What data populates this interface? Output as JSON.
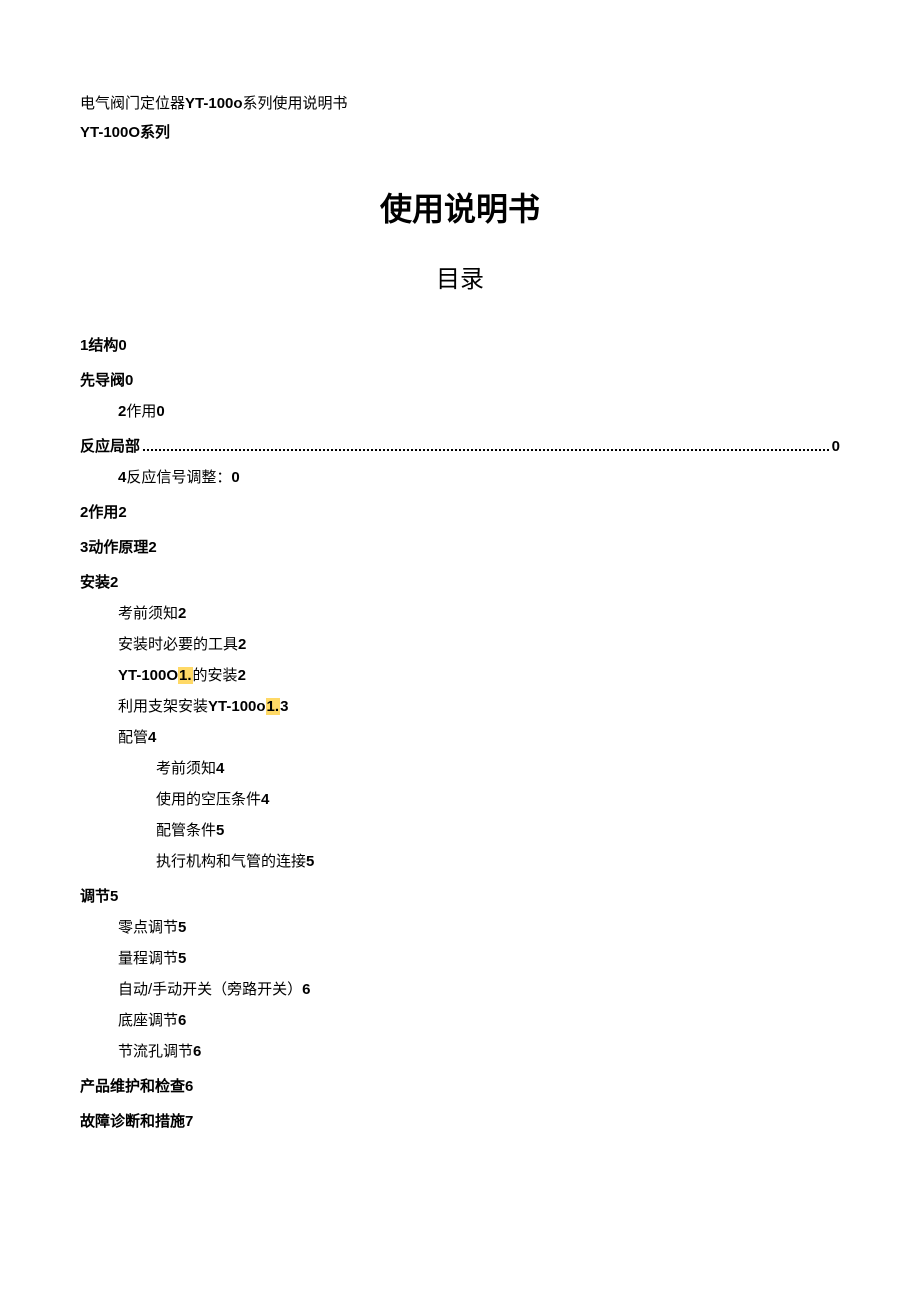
{
  "header": {
    "line1_prefix": "电气阀门定位器",
    "line1_model": "YT-100o",
    "line1_suffix": "系列使用说明书",
    "line2": "YT-100O系列"
  },
  "title": "使用说明书",
  "subtitle": "目录",
  "toc": {
    "e1": {
      "num": "1",
      "text": "结构",
      "page": "0"
    },
    "e2": {
      "text": "先导阀",
      "page": "0"
    },
    "e3": {
      "num": "2",
      "text": "作用",
      "page": "0"
    },
    "e4": {
      "text": "反应局部",
      "page": "0"
    },
    "e5": {
      "num": "4",
      "text": "反应信号调整：",
      "page": "0"
    },
    "e6": {
      "num": "2",
      "text": "作用",
      "page": "2"
    },
    "e7": {
      "num": "3",
      "text": "动作原理",
      "page": "2"
    },
    "e8": {
      "text": "安装",
      "page": "2"
    },
    "e9": {
      "text": "考前须知",
      "page": "2"
    },
    "e10": {
      "text": "安装时必要的工具",
      "page": "2"
    },
    "e11": {
      "text_a": "YT-100O",
      "hl": "1.",
      "text_b": "的安装",
      "page": "2"
    },
    "e12": {
      "text_a": "利用支架安装",
      "text_b": "YT-100o",
      "hl": "1.",
      "page": "3"
    },
    "e13": {
      "text": "配管",
      "page": "4"
    },
    "e14": {
      "text": "考前须知",
      "page": "4"
    },
    "e15": {
      "text": "使用的空压条件",
      "page": "4"
    },
    "e16": {
      "text": "配管条件",
      "page": "5"
    },
    "e17": {
      "text": "执行机构和气管的连接",
      "page": "5"
    },
    "e18": {
      "text": "调节",
      "page": "5"
    },
    "e19": {
      "text": "零点调节",
      "page": "5"
    },
    "e20": {
      "text": "量程调节",
      "page": "5"
    },
    "e21": {
      "text": "自动/手动开关（旁路开关）",
      "page": "6"
    },
    "e22": {
      "text": "底座调节",
      "page": "6"
    },
    "e23": {
      "text": "节流孔调节",
      "page": "6"
    },
    "e24": {
      "text": "产品维护和检查",
      "page": "6"
    },
    "e25": {
      "text": "故障诊断和措施",
      "page": "7"
    }
  }
}
